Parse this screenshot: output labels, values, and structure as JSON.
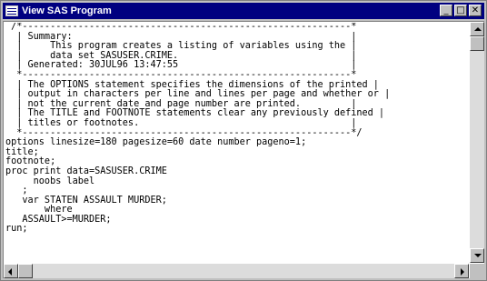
{
  "window": {
    "title": "View SAS Program",
    "controls": {
      "minimize": "_",
      "maximize": "□",
      "close": "✕"
    }
  },
  "code_lines": [
    " /*-----------------------------------------------------------*",
    "  | Summary:                                                  |",
    "  |     This program creates a listing of variables using the |",
    "  |     data set SASUSER.CRIME.                               |",
    "  | Generated: 30JUL96 13:47:55                               |",
    "  *-----------------------------------------------------------*",
    "  | The OPTIONS statement specifies the dimensions of the printed |",
    "  | output in characters per line and lines per page and whether or |",
    "  | not the current date and page number are printed.         |",
    "  | The TITLE and FOOTNOTE statements clear any previously defined |",
    "  | titles or footnotes.                                      |",
    "  *-----------------------------------------------------------*/",
    "options linesize=180 pagesize=60 date number pageno=1;",
    "title;",
    "footnote;",
    "proc print data=SASUSER.CRIME",
    "     noobs label",
    "   ;",
    "   var STATEN ASSAULT MURDER;",
    "       where",
    "   ASSAULT>=MURDER;",
    "run;",
    "",
    ""
  ],
  "scroll": {
    "vertical": 0.0,
    "horizontal": 0.0
  }
}
